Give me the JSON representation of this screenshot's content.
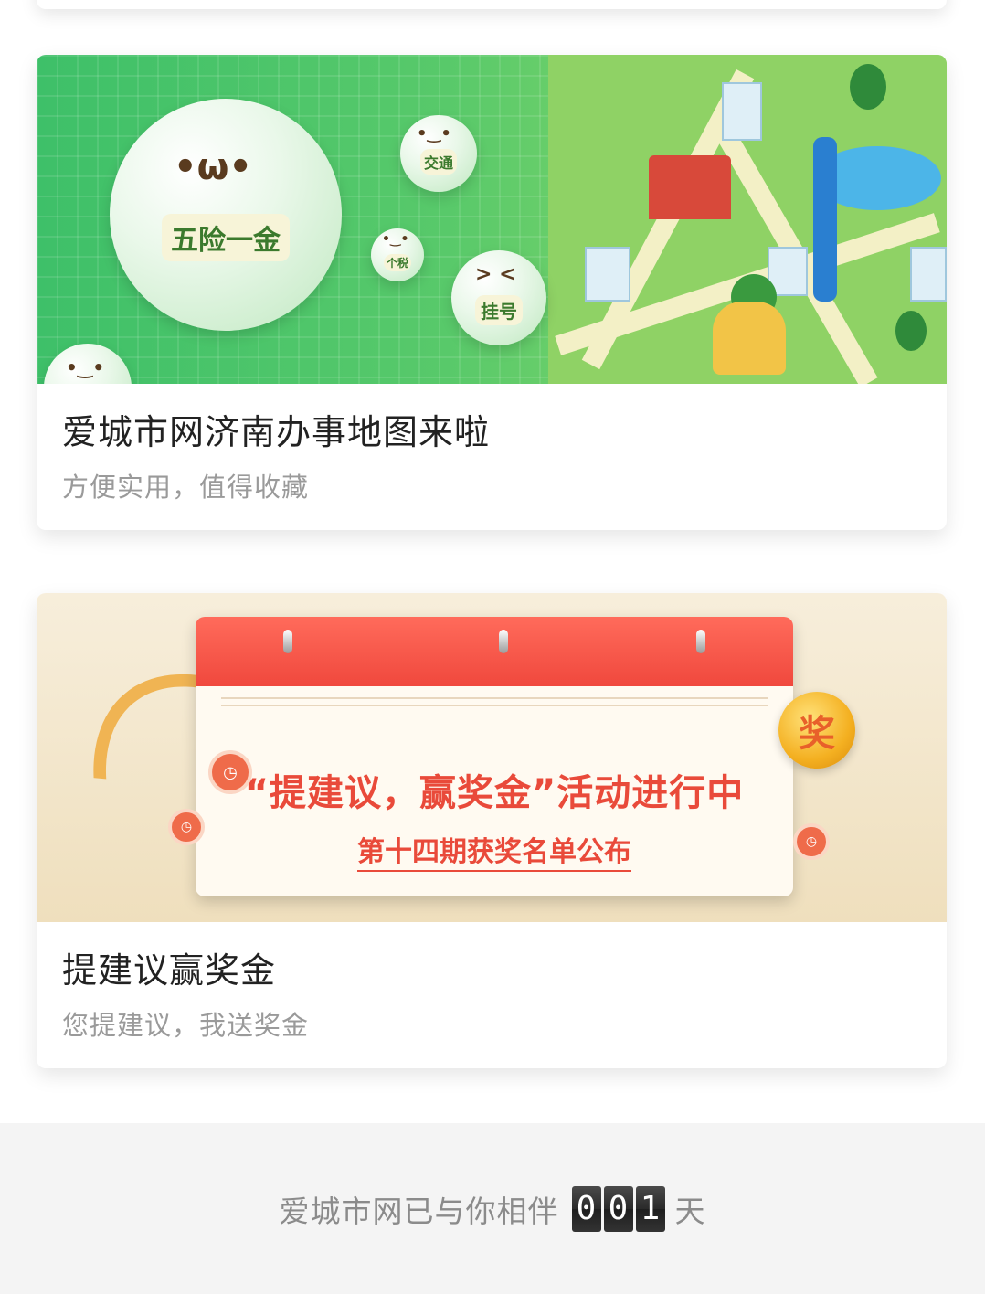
{
  "cards": [
    {
      "title": "爱城市网济南办事地图来啦",
      "subtitle": "方便实用，值得收藏",
      "banner": {
        "main_bubble_label": "五险一金",
        "bubble_traffic": "交通",
        "bubble_tax": "个税",
        "bubble_registration": "挂号",
        "face_main": "•ω•",
        "face_small": "•‿•",
        "face_wink": "> <"
      }
    },
    {
      "title": "提建议赢奖金",
      "subtitle": "您提建议，我送奖金",
      "banner": {
        "headline": "“提建议，赢奖金”活动进行中",
        "subline": "第十四期获奖名单公布",
        "medal_text": "奖"
      }
    }
  ],
  "footer": {
    "prefix": "爱城市网已与你相伴",
    "digits": [
      "0",
      "0",
      "1"
    ],
    "suffix": "天"
  },
  "colors": {
    "accent_green": "#3ec069",
    "calendar_red": "#f0483d",
    "medal_gold": "#f4b021"
  }
}
